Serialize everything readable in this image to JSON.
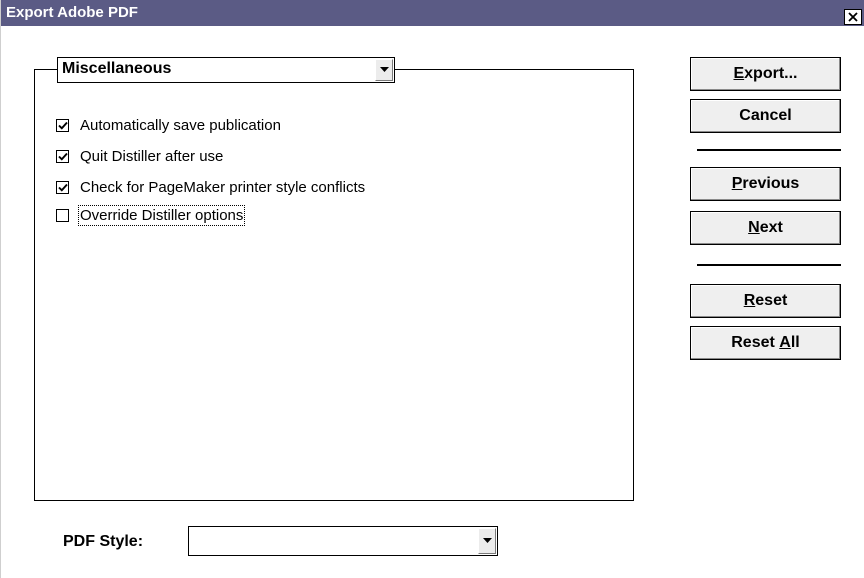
{
  "window": {
    "title": "Export Adobe PDF",
    "close_glyph": "✕"
  },
  "section": {
    "selected": "Miscellaneous"
  },
  "options": [
    {
      "label": "Automatically save publication",
      "checked": true
    },
    {
      "label": "Quit Distiller after use",
      "checked": true
    },
    {
      "label": "Check for PageMaker printer style conflicts",
      "checked": true
    },
    {
      "label": "Override Distiller options",
      "checked": false
    }
  ],
  "buttons": {
    "export": {
      "mnemonic": "E",
      "rest": "xport..."
    },
    "cancel": {
      "label": "Cancel"
    },
    "previous": {
      "mnemonic": "P",
      "rest": "revious"
    },
    "next": {
      "mnemonic": "N",
      "rest": "ext"
    },
    "reset": {
      "mnemonic": "R",
      "rest": "eset"
    },
    "reset_all": {
      "prefix": "Reset ",
      "mnemonic": "A",
      "rest": "ll"
    }
  },
  "pdf_style": {
    "label": "PDF Style:",
    "value": ""
  },
  "colors": {
    "titlebar": "#5b5b85",
    "window_bg": "#ffffff",
    "button_face": "#efefef"
  },
  "icons": {
    "close": "close-icon",
    "dropdown": "chevron-down-icon",
    "check": "check-icon"
  }
}
